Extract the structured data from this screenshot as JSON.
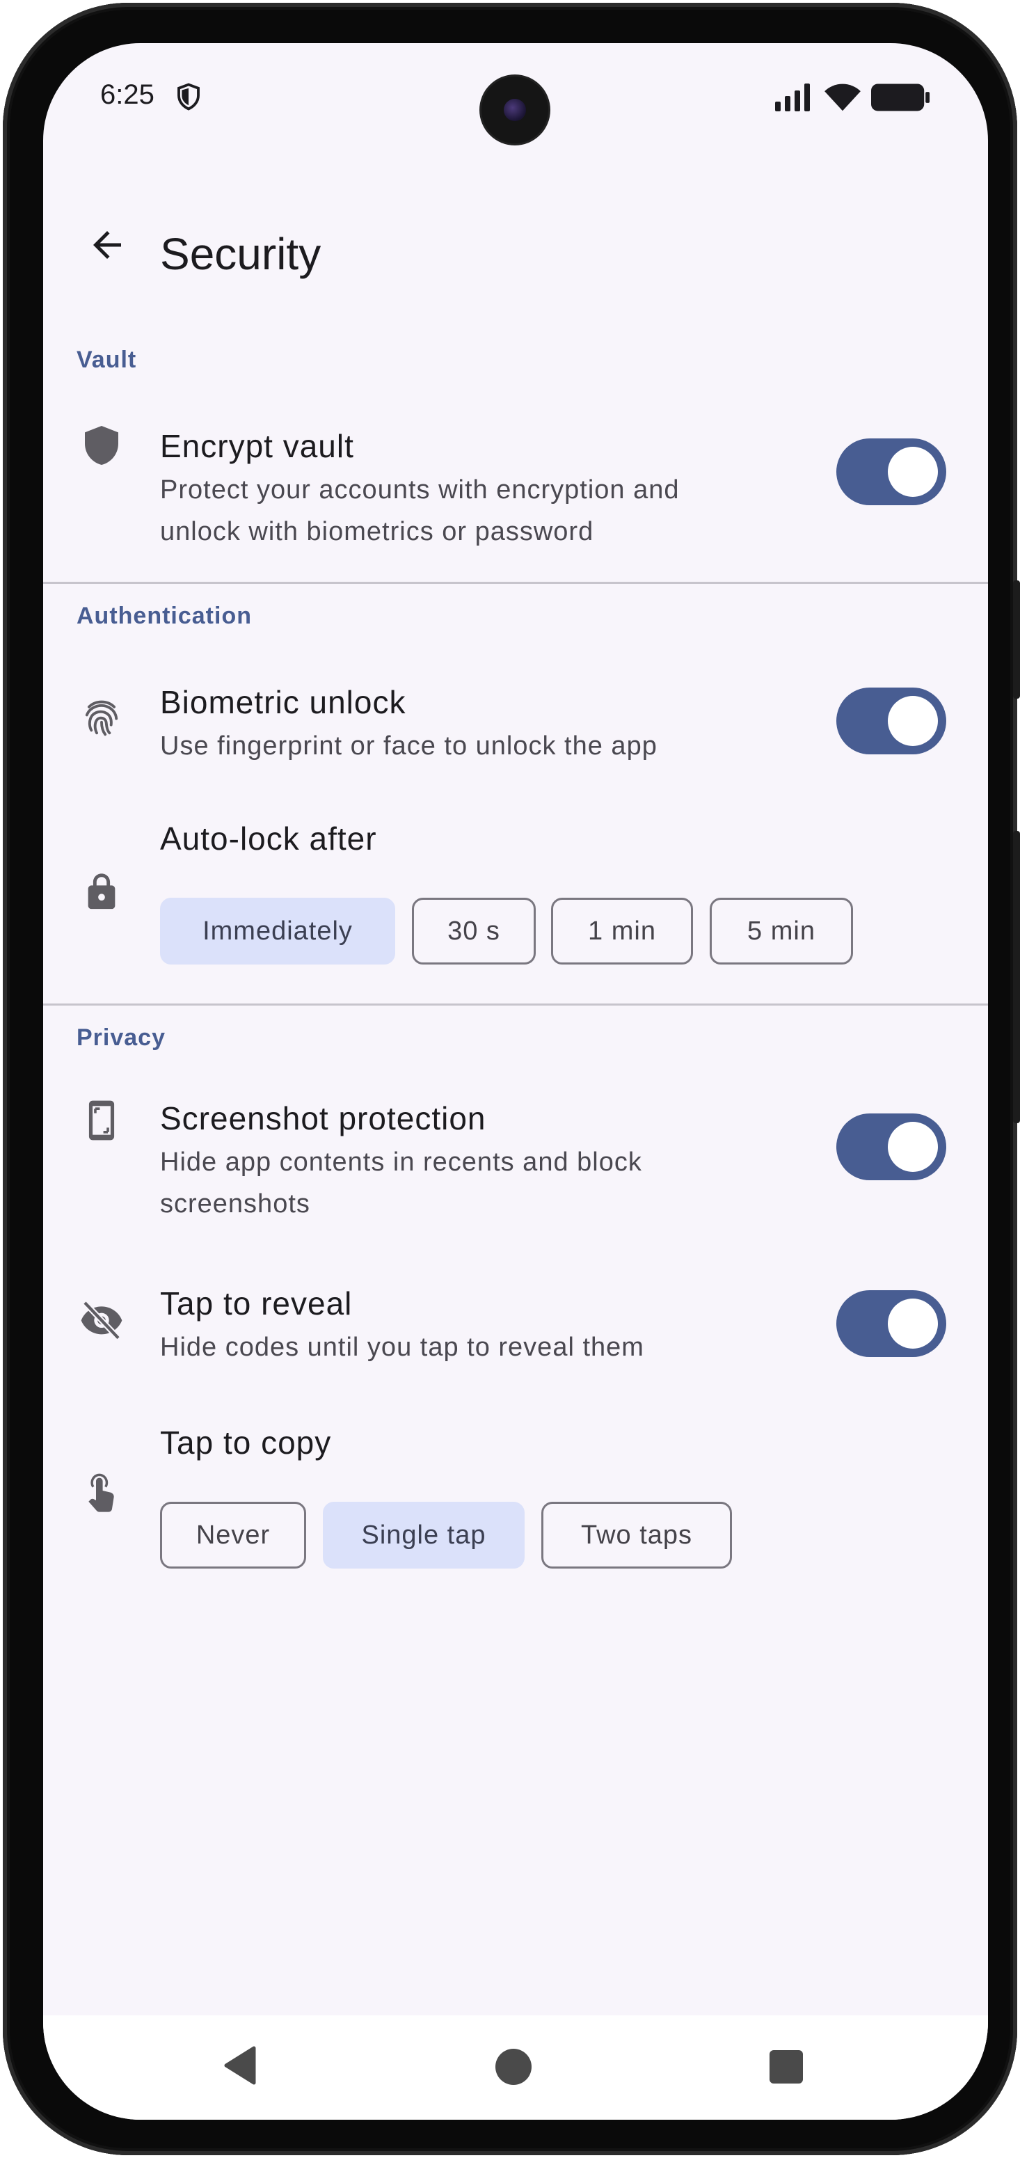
{
  "status_bar": {
    "time": "6:25"
  },
  "app_bar": {
    "title": "Security"
  },
  "sections": {
    "vault": {
      "header": "Vault",
      "encrypt": {
        "title": "Encrypt vault",
        "subtitle_line1": "Protect your accounts with encryption and",
        "subtitle_line2": "unlock with biometrics or password",
        "enabled": true
      }
    },
    "authentication": {
      "header": "Authentication",
      "biometric": {
        "title": "Biometric unlock",
        "subtitle": "Use fingerprint or face to unlock the app",
        "enabled": true
      },
      "auto_lock": {
        "title": "Auto-lock after",
        "options": [
          "Immediately",
          "30 s",
          "1 min",
          "5 min"
        ],
        "selected": "Immediately"
      }
    },
    "privacy": {
      "header": "Privacy",
      "screenshot": {
        "title": "Screenshot protection",
        "subtitle_line1": "Hide app contents in recents and block",
        "subtitle_line2": "screenshots",
        "enabled": true
      },
      "reveal": {
        "title": "Tap to reveal",
        "subtitle": "Hide codes until you tap to reveal them",
        "enabled": true
      },
      "copy": {
        "title": "Tap to copy",
        "options": [
          "Never",
          "Single tap",
          "Two taps"
        ],
        "selected": "Single tap"
      }
    }
  },
  "colors": {
    "accent": "#485d92",
    "chip_selected": "#dbe1fa",
    "background": "#f8f5fb"
  },
  "icons": {
    "back": "arrow-back-icon",
    "vault": "shield-icon",
    "biometric": "fingerprint-icon",
    "auto_lock": "lock-icon",
    "screenshot": "screenshot-frame-icon",
    "reveal": "eye-off-icon",
    "copy": "touch-icon"
  }
}
